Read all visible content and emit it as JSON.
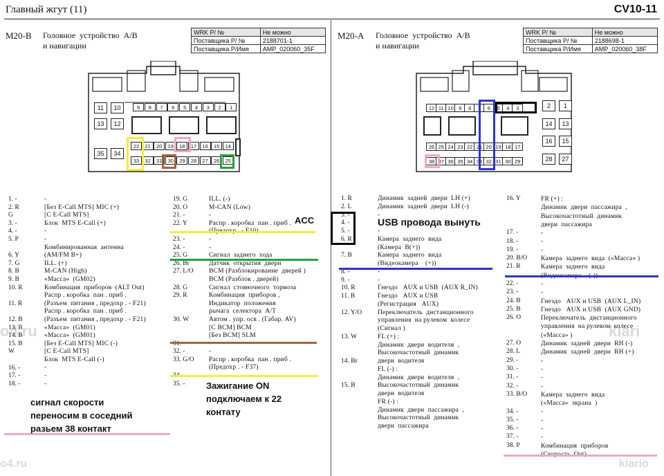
{
  "header": {
    "title": "Главный  жгут  (11)",
    "code": "CV10-11"
  },
  "left": {
    "id": "M20-B",
    "name": "Головное  устройство  А/В\nи навигации",
    "info": [
      [
        "WRK P/ №",
        "Не можно"
      ],
      [
        "Поставщика  P/ №",
        "2188701-1"
      ],
      [
        "Поставщика  P/Имя",
        "AMP_020060_35F"
      ]
    ],
    "pins_row1": [
      "9",
      "8",
      "7",
      "6",
      "5",
      "4",
      "3",
      "2",
      "1"
    ],
    "pins_row2": [
      "22",
      "21",
      "20",
      "19",
      "18",
      "17",
      "16",
      "15",
      "14"
    ],
    "pins_row3": [
      "33",
      "32",
      "31",
      "30",
      "29",
      "28",
      "27",
      "26",
      "25"
    ],
    "pins_side": [
      "11",
      "10",
      "13",
      "12",
      "35",
      "34"
    ],
    "col1_nums": [
      "1. -",
      "2. R",
      "G",
      "3. -",
      "4. -",
      "5. P",
      "",
      "6. Y",
      "7. G",
      "8. B",
      "9. B",
      "10. R",
      "",
      "11. R",
      "",
      "12. B",
      "13. B",
      "14. B",
      "15. B",
      "W",
      "",
      "16. -",
      "17. -",
      "18. -"
    ],
    "col1_desc": "-\n[Без E-Call MTS] MIC (+)\n[C E-Call MTS]\nБлок  MTS E-Call (+)\n-\n-\nКомбинированная  антенна\n(AM/FM В+)\nILL. (+)\nM-CAN (High)\n«Масса»  (GM02)\nКомбинация  приборов  (ALT Out)\nРаспр . коробка  пан . приб .\n(Разъем  питания , предохр . - F21)\nРаспр . коробка  пан . приб .\n(Разъем  питания , предохр . - F21)\n«Масса»  (GM01)\n«Масса»  (GM01)\n[Без E-Call MTS] MIC (-)\n[C E-Call MTS]\nБлок  MTS E-Call (-)\n-\n-\n-",
    "col2_nums": [
      "19. G",
      "20. O",
      "21. -",
      "22. Y",
      "",
      "23. -",
      "24. -",
      "25. G",
      "26. Br",
      "27. L/O",
      "",
      "28. G",
      "29. R",
      "",
      "",
      "30. W",
      "",
      "",
      "31. -",
      "32. -",
      "33. G/O",
      "",
      "34. -",
      "35. -"
    ],
    "col2_desc": "ILL. (-)\nM-CAN (Low)\n-\nРаспр . коробка  пан . приб .\n(Предохр . - F10)\n-\n-\nСигнал  заднего  хода\nДатчик  открытия  двери\nBCM (Разблокирование  дверей )\nBCM (Разблок . дверей)\nСигнал  стояночного  тормоза\nКомбинация  приборов ,\nИндикатор  положения\nрычага  селектора  A/T\nАвтом . упр. осв . (Габар. AV)\n[C BCM] BCM\n[Без BCM] SLM\n-\n-\nРаспр . коробка  пан . приб .\n(Предохр . - F37)\n-\n-"
  },
  "right": {
    "id": "M20-A",
    "name": "Головное  устройство  А/В\nи навигации",
    "info": [
      [
        "WRK P/ №",
        "Не можно"
      ],
      [
        "Поставщика  P/ №",
        "2188698-1"
      ],
      [
        "Поставщика  P/Имя",
        "AMP_020060_38F"
      ]
    ],
    "pins_row1": [
      "12",
      "11",
      "10",
      "9",
      "8",
      "7",
      "6",
      "5",
      "4",
      "3"
    ],
    "pins_row2": [
      "26",
      "25",
      "24",
      "23",
      "22",
      "21",
      "20",
      "19",
      "18",
      "17"
    ],
    "pins_row3": [
      "38",
      "37",
      "36",
      "35",
      "34",
      "33",
      "32",
      "31",
      "30",
      "29"
    ],
    "pins_side": [
      "2",
      "1",
      "14",
      "13",
      "16",
      "15",
      "28",
      "27"
    ],
    "col1_nums": [
      "1. R",
      "2. L",
      "3. -",
      "4. -",
      "5. -",
      "6. R",
      "",
      "7. B",
      "",
      "8. -",
      "9. -",
      "10. R",
      "11. B",
      "",
      "12. Y/O",
      "",
      "",
      "13. W",
      "",
      "",
      "14. Br",
      "",
      "",
      "15. B",
      "",
      ""
    ],
    "col1_desc": "Динамик  задней  двери  LH (+)\nДинамик  задней  двери  LH (-)\n-\n-\n-\nКамера  заднего  вида\n(Камера  В(+))\nКамера  заднего  вида\n(Видеокамера    (+))\n-\n-\nГнездо   AUX и USB  (AUX R_IN)\nГнездо   AUX и USB\n(Регистрация   AUX)\nПереключатель  дистанционного\nуправления  на рулевом  колесе\n(Сигнал )\nFL (+) :\nДинамик  двери  водителя  ,\nВысокочастотный  динамик\nдвери  водителя\nFL (-) :\nДинамик  двери  водителя  ,\nВысокочастотный  динамик\nдвери  водителя\nFR (-) :\nДинамик  двери  пассажира  ,\nВысокочастотный  динамик\nдвери  пассажира",
    "col2_nums": [
      "16. Y",
      "",
      "",
      "",
      "17. -",
      "18. -",
      "19. -",
      "20. B/O",
      "21. R",
      "",
      "22. -",
      "23. -",
      "24. B",
      "25. B",
      "26. O",
      "",
      "",
      "27. O",
      "28. L",
      "29. -",
      "30. -",
      "31. -",
      "32. -",
      "33. B/O",
      "",
      "34. -",
      "35. -",
      "36. -",
      "37. -",
      "38. P",
      ""
    ],
    "col2_desc": "FR (+) :\nДинамик  двери  пассажира  ,\nВысокочастотный  динамик\nдвери  пассажира\n-\n-\n-\nКамера  заднего  вида  («Масса» )\nКамера  заднего  вида\n(Видеокамера    (-))\n-\n-\nГнездо   AUX и USB  (AUX L_IN)\nГнездо   AUX и USB  (AUX GND)\nПереключатель  дистанционного\nуправления  на рулевом  колесе\n(«Масса» )\nДинамик  задней  двери  RH (-)\nДинамик  задней  двери  RH (+)\n-\n-\n-\n-\nКамера  заднего  вида\n(«Масса»  экрана  )\n-\n-\n-\n-\nКомбинация  приборов\n(Скорость  Out)"
  },
  "annotations": {
    "acc": "ACC",
    "usb": "USB провода вынуть",
    "ignition": "Зажигание ON\nподключаем к 22\nконтату",
    "speed": "сигнал скорости\nпереносим в соседний\nразьем 38 контакт"
  },
  "watermarks": {
    "left": "o4.ru",
    "mid": "kiari",
    "bottom_left": "o4.ru",
    "bottom_right": "kiario"
  },
  "colors": {
    "yellow": "#f2ee3a",
    "green": "#22a33c",
    "brown": "#a0643c",
    "blue": "#2b36c8",
    "pink": "#f2a8c2",
    "black": "#000000"
  }
}
